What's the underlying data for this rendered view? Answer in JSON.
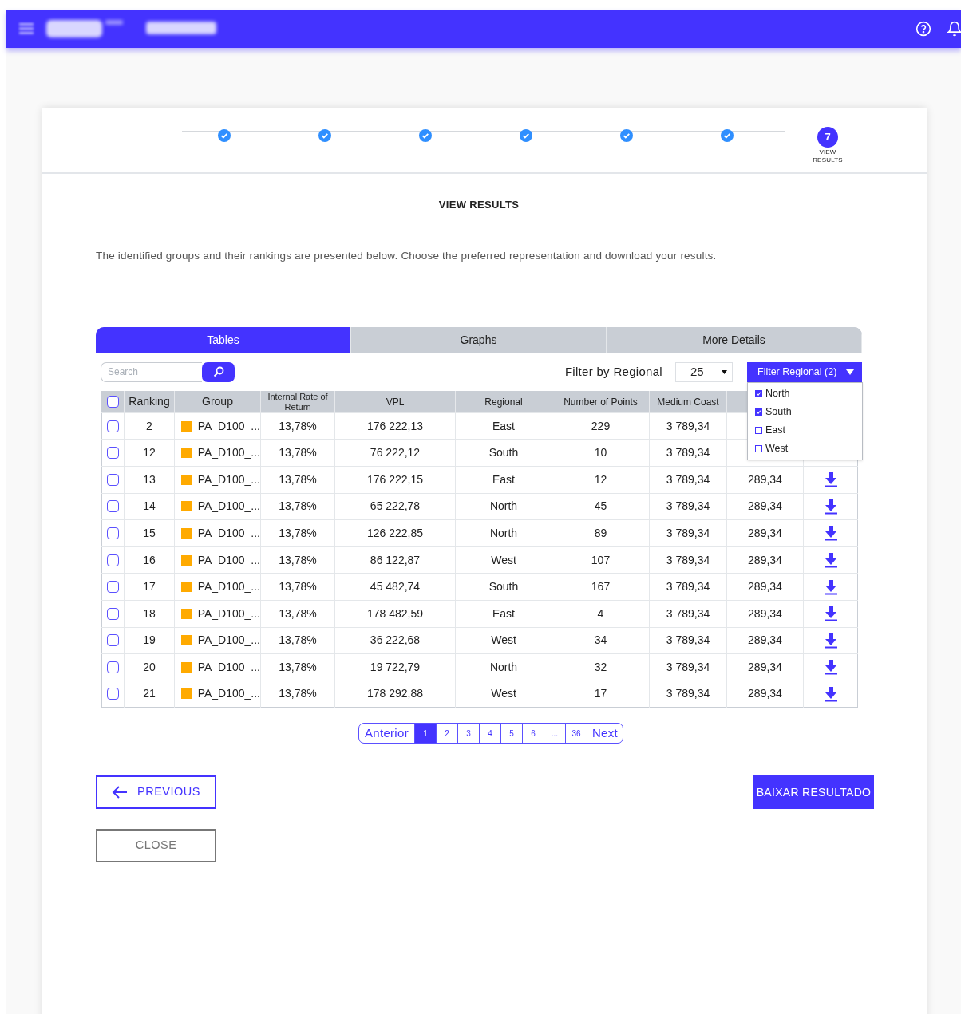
{
  "stepper": {
    "steps": [
      {
        "done": true
      },
      {
        "done": true
      },
      {
        "done": true
      },
      {
        "done": true
      },
      {
        "done": true
      },
      {
        "done": true
      },
      {
        "done": false,
        "number": "7",
        "label": "VIEW RESULTS"
      }
    ]
  },
  "heading": "VIEW RESULTS",
  "intro": "The identified groups and their rankings are presented below. Choose the preferred representation and download your results.",
  "tabs": [
    {
      "label": "Tables",
      "selected": true
    },
    {
      "label": "Graphs",
      "selected": false
    },
    {
      "label": "More Details",
      "selected": false
    }
  ],
  "search": {
    "placeholder": "Search"
  },
  "filter_label": "Filter by Regional",
  "page_size": "25",
  "filter_dropdown": {
    "label": "Filter Regional (2)",
    "options": [
      {
        "label": "North",
        "checked": true
      },
      {
        "label": "South",
        "checked": true
      },
      {
        "label": "East",
        "checked": false
      },
      {
        "label": "West",
        "checked": false
      }
    ]
  },
  "table": {
    "select_all": false,
    "columns": [
      "Ranking",
      "Group",
      "Internal Rate of Return",
      "VPL",
      "Regional",
      "Number of Points",
      "Medium Coast"
    ],
    "rows": [
      {
        "checked": false,
        "ranking": "2",
        "group": "PA_D100_...",
        "color": "#ffaa00",
        "irr": "13,78%",
        "vpl": "176 222,13",
        "regional": "East",
        "points": "229",
        "medium_coast": "3 789,34"
      },
      {
        "checked": false,
        "ranking": "12",
        "group": "PA_D100_...",
        "color": "#ffaa00",
        "irr": "13,78%",
        "vpl": "76 222,12",
        "regional": "South",
        "points": "10",
        "medium_coast": "3 789,34"
      },
      {
        "checked": false,
        "ranking": "13",
        "group": "PA_D100_...",
        "color": "#ffaa00",
        "irr": "13,78%",
        "vpl": "176 222,15",
        "regional": "East",
        "points": "12",
        "medium_coast": "3 789,34",
        "column_9": "289,34"
      },
      {
        "checked": false,
        "ranking": "14",
        "group": "PA_D100_...",
        "color": "#ffaa00",
        "irr": "13,78%",
        "vpl": "65 222,78",
        "regional": "North",
        "points": "45",
        "medium_coast": "3 789,34",
        "column_9": "289,34"
      },
      {
        "checked": false,
        "ranking": "15",
        "group": "PA_D100_...",
        "color": "#ffaa00",
        "irr": "13,78%",
        "vpl": "126 222,85",
        "regional": "North",
        "points": "89",
        "medium_coast": "3 789,34",
        "column_9": "289,34"
      },
      {
        "checked": false,
        "ranking": "16",
        "group": "PA_D100_...",
        "color": "#ffaa00",
        "irr": "13,78%",
        "vpl": "86 122,87",
        "regional": "West",
        "points": "107",
        "medium_coast": "3 789,34",
        "column_9": "289,34"
      },
      {
        "checked": false,
        "ranking": "17",
        "group": "PA_D100_...",
        "color": "#ffaa00",
        "irr": "13,78%",
        "vpl": "45 482,74",
        "regional": "South",
        "points": "167",
        "medium_coast": "3 789,34",
        "column_9": "289,34"
      },
      {
        "checked": false,
        "ranking": "18",
        "group": "PA_D100_...",
        "color": "#ffaa00",
        "irr": "13,78%",
        "vpl": "178 482,59",
        "regional": "East",
        "points": "4",
        "medium_coast": "3 789,34",
        "column_9": "289,34"
      },
      {
        "checked": false,
        "ranking": "19",
        "group": "PA_D100_...",
        "color": "#ffaa00",
        "irr": "13,78%",
        "vpl": "36 222,68",
        "regional": "West",
        "points": "34",
        "medium_coast": "3 789,34",
        "column_9": "289,34"
      },
      {
        "checked": false,
        "ranking": "20",
        "group": "PA_D100_...",
        "color": "#ffaa00",
        "irr": "13,78%",
        "vpl": "19 722,79",
        "regional": "North",
        "points": "32",
        "medium_coast": "3 789,34",
        "column_9": "289,34"
      },
      {
        "checked": false,
        "ranking": "21",
        "group": "PA_D100_...",
        "color": "#ffaa00",
        "irr": "13,78%",
        "vpl": "178 292,88",
        "regional": "West",
        "points": "17",
        "medium_coast": "3 789,34",
        "column_9": "289,34"
      }
    ]
  },
  "pagination": {
    "previous": "Anterior",
    "next": "Next",
    "pages": [
      {
        "label": "1",
        "selected": true
      },
      {
        "label": "2",
        "selected": false
      },
      {
        "label": "3",
        "selected": false
      },
      {
        "label": "4",
        "selected": false
      },
      {
        "label": "5",
        "selected": false
      },
      {
        "label": "6",
        "selected": false
      },
      {
        "label": "...",
        "selected": false
      },
      {
        "label": "36",
        "selected": false
      }
    ]
  },
  "buttons": {
    "previous": "PREVIOUS",
    "download": "BAIXAR RESULTADO",
    "close": "CLOSE"
  }
}
